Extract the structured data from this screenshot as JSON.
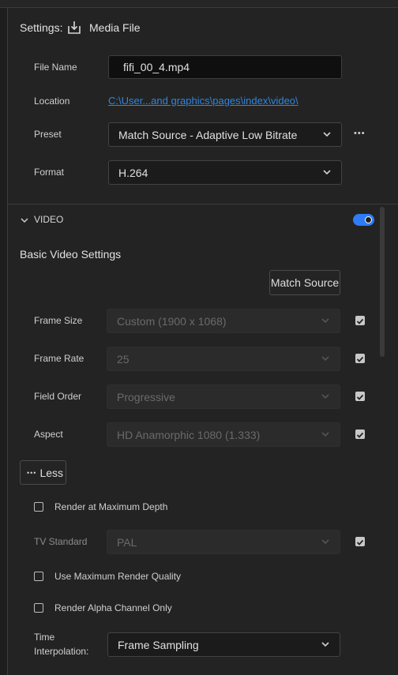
{
  "header": {
    "settings_label": "Settings:",
    "media_file_label": "Media File",
    "export_icon": "export-download-icon"
  },
  "file": {
    "name_label": "File Name",
    "name_value": "fifi_00_4.mp4",
    "location_label": "Location",
    "location_value": "C:\\User...and graphics\\pages\\index\\video\\",
    "preset_label": "Preset",
    "preset_value": "Match Source - Adaptive Low Bitrate",
    "preset_more": "•••",
    "format_label": "Format",
    "format_value": "H.264"
  },
  "video": {
    "section_title": "VIDEO",
    "enabled": true,
    "basic_title": "Basic Video Settings",
    "match_source_button": "Match Source",
    "rows": [
      {
        "label": "Frame Size",
        "value": "Custom (1900 x 1068)",
        "checked": true
      },
      {
        "label": "Frame Rate",
        "value": "25",
        "checked": true
      },
      {
        "label": "Field Order",
        "value": "Progressive",
        "checked": true
      },
      {
        "label": "Aspect",
        "value": "HD Anamorphic 1080 (1.333)",
        "checked": true
      }
    ],
    "less_button": "Less",
    "less_dots": "•••",
    "render_max_depth": {
      "label": "Render at Maximum Depth",
      "checked": false
    },
    "tv_standard": {
      "label": "TV Standard",
      "value": "PAL",
      "checked": true
    },
    "max_render_quality": {
      "label": "Use Maximum Render Quality",
      "checked": false
    },
    "alpha_only": {
      "label": "Render Alpha Channel Only",
      "checked": false
    },
    "time_interp": {
      "label_line1": "Time",
      "label_line2": "Interpolation:",
      "value": "Frame Sampling"
    }
  },
  "colors": {
    "accent": "#2e7cf6",
    "link": "#2e86de",
    "panel_bg": "#232323"
  }
}
